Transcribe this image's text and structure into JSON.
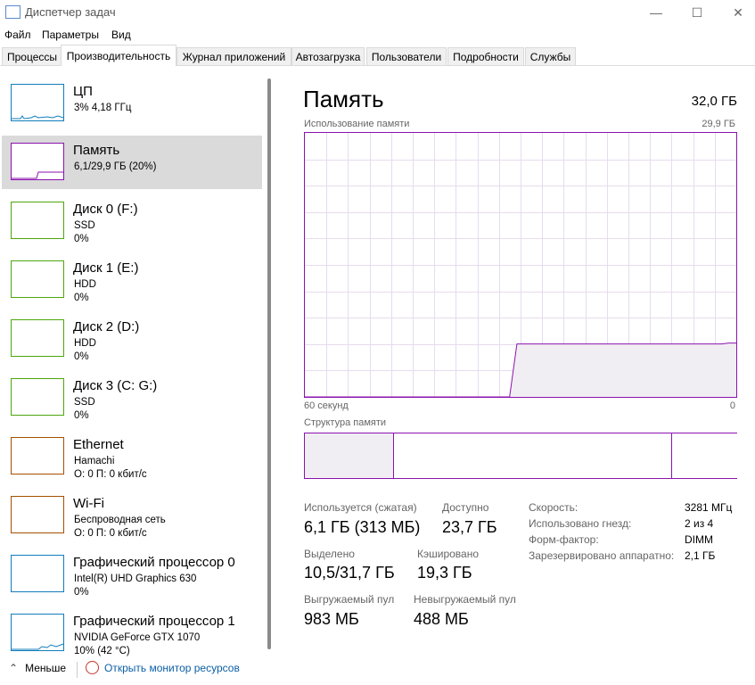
{
  "window": {
    "title": "Диспетчер задач",
    "min_glyph": "—",
    "max_glyph": "☐",
    "close_glyph": "✕"
  },
  "menu": [
    "Файл",
    "Параметры",
    "Вид"
  ],
  "tabs": [
    "Процессы",
    "Производительность",
    "Журнал приложений",
    "Автозагрузка",
    "Пользователи",
    "Подробности",
    "Службы"
  ],
  "active_tab": 1,
  "resources": [
    {
      "title": "ЦП",
      "line2": "3% 4,18 ГГц",
      "line3": "",
      "color": "#117dbb"
    },
    {
      "title": "Память",
      "line2": "6,1/29,9 ГБ (20%)",
      "line3": "",
      "color": "#8b12ae"
    },
    {
      "title": "Диск 0 (F:)",
      "line2": "SSD",
      "line3": "0%",
      "color": "#4da60c"
    },
    {
      "title": "Диск 1 (E:)",
      "line2": "HDD",
      "line3": "0%",
      "color": "#4da60c"
    },
    {
      "title": "Диск 2 (D:)",
      "line2": "HDD",
      "line3": "0%",
      "color": "#4da60c"
    },
    {
      "title": "Диск 3 (C: G:)",
      "line2": "SSD",
      "line3": "0%",
      "color": "#4da60c"
    },
    {
      "title": "Ethernet",
      "line2": "Hamachi",
      "line3": "О: 0 П: 0 кбит/с",
      "color": "#a74f01"
    },
    {
      "title": "Wi-Fi",
      "line2": "Беспроводная сеть",
      "line3": "О: 0 П: 0 кбит/с",
      "color": "#a74f01"
    },
    {
      "title": "Графический процессор 0",
      "line2": "Intel(R) UHD Graphics 630",
      "line3": "0%",
      "color": "#117dbb"
    },
    {
      "title": "Графический процессор 1",
      "line2": "NVIDIA GeForce GTX 1070",
      "line3": "10% (42 °C)",
      "color": "#117dbb"
    }
  ],
  "memory": {
    "title": "Память",
    "total": "32,0 ГБ",
    "usage_label": "Использование памяти",
    "usage_max": "29,9 ГБ",
    "time_label": "60 секунд",
    "time_zero": "0",
    "struct_label": "Структура памяти",
    "usage_history_gb": [
      0,
      0,
      0,
      0,
      0,
      0,
      0,
      0,
      0,
      0,
      0,
      0,
      0,
      0,
      0,
      0,
      0,
      0,
      0,
      0,
      0,
      0,
      0,
      0,
      0,
      0,
      0,
      0,
      0,
      6.0,
      6.0,
      6.0,
      6.0,
      6.0,
      6.0,
      6.0,
      6.0,
      6.0,
      6.0,
      6.0,
      6.0,
      6.0,
      6.0,
      6.0,
      6.0,
      6.0,
      6.0,
      6.0,
      6.0,
      6.0,
      6.0,
      6.0,
      6.0,
      6.0,
      6.0,
      6.0,
      6.0,
      6.0,
      6.1,
      6.1
    ],
    "usage_max_gb": 29.9,
    "struct_fractions": {
      "in_use": 0.205,
      "modified": 0.0,
      "standby": 0.645,
      "free": 0.15
    },
    "colors": {
      "accent": "#8b12ae",
      "fill": "#f1eef3",
      "grid": "#e6dcee"
    },
    "stats": {
      "in_use_label": "Используется (сжатая)",
      "in_use_value": "6,1 ГБ (313 МБ)",
      "available_label": "Доступно",
      "available_value": "23,7 ГБ",
      "committed_label": "Выделено",
      "committed_value": "10,5/31,7 ГБ",
      "cached_label": "Кэшировано",
      "cached_value": "19,3 ГБ",
      "paged_label": "Выгружаемый пул",
      "paged_value": "983 МБ",
      "nonpaged_label": "Невыгружаемый пул",
      "nonpaged_value": "488 МБ"
    },
    "details": [
      {
        "label": "Скорость:",
        "value": "3281 МГц"
      },
      {
        "label": "Использовано гнезд:",
        "value": "2 из 4"
      },
      {
        "label": "Форм-фактор:",
        "value": "DIMM"
      },
      {
        "label": "Зарезервировано аппаратно:",
        "value": "2,1 ГБ"
      }
    ]
  },
  "footer": {
    "fewer_label": "Меньше",
    "fewer_glyph": "⌃",
    "monitor_link": "Открыть монитор ресурсов"
  }
}
